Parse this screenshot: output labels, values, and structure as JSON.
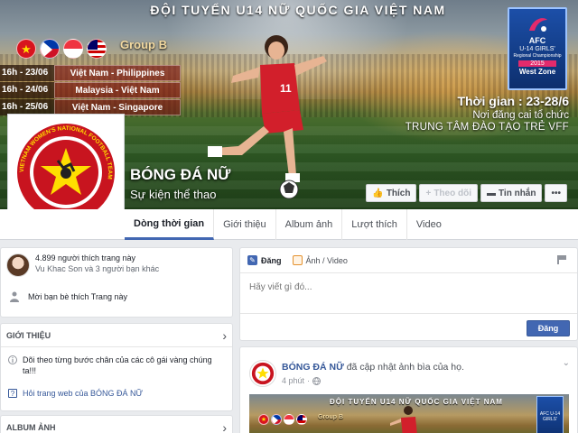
{
  "cover": {
    "title": "ĐỘI TUYỂN U14 NỮ QUỐC GIA VIỆT NAM",
    "group": "Group B",
    "fixtures": [
      {
        "date": "16h - 23/06",
        "match": "Việt Nam - Philippines"
      },
      {
        "date": "16h - 24/06",
        "match": "Malaysia - Việt Nam"
      },
      {
        "date": "16h - 25/06",
        "match": "Việt Nam - Singapore"
      }
    ],
    "afc": {
      "name": "AFC",
      "line1": "U-14 GIRLS'",
      "line2": "Regional Championship",
      "year": "2015",
      "zone": "West Zone"
    },
    "time": "Thời gian : 23-28/6",
    "host_label": "Nơi đăng cai tổ chức",
    "host": "TRUNG TÂM ĐÀO TẠO TRẺ VFF",
    "page_name": "BÓNG ĐÁ NỮ",
    "category": "Sự kiện thể thao",
    "buttons": {
      "like": "Thích",
      "follow": "Theo dõi",
      "message": "Tin nhắn",
      "more": "•••"
    }
  },
  "profile": {
    "logo_text": "VIETNAM WOMEN'S NATIONAL FOOTBALL TEAM"
  },
  "tabs": [
    "Dòng thời gian",
    "Giới thiệu",
    "Album ảnh",
    "Lượt thích",
    "Video"
  ],
  "likes": {
    "count_text": "4.899 người thích trang này",
    "friends_text": "Vu Khac Son và 3 người bạn khác",
    "invite_text": "Mời bạn bè thích Trang này"
  },
  "intro": {
    "heading": "GIỚI THIỆU",
    "description": "Dõi theo từng bước chân của các cô gái vàng chúng ta!!!",
    "link": "Hỏi trang web của BÓNG ĐÁ NỮ"
  },
  "album": {
    "heading": "ALBUM ẢNH"
  },
  "composer": {
    "tab_post": "Đăng",
    "tab_photo": "Ảnh / Video",
    "placeholder": "Hãy viết gì đó...",
    "post_button": "Đăng"
  },
  "post": {
    "author": "BÓNG ĐÁ NỮ",
    "action": "đã cập nhật ảnh bìa của họ.",
    "time": "4 phút",
    "image_title": "ĐỘI TUYỂN U14 NỮ QUỐC GIA VIỆT NAM",
    "image_group": "Group B",
    "image_afc": "AFC U-14 GIRLS'"
  },
  "colors": {
    "fb_blue": "#4267b2",
    "link": "#365899",
    "vn_red": "#d8141e",
    "star": "#ffde00"
  }
}
